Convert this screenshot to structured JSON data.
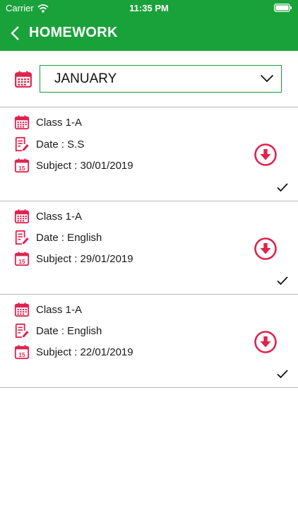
{
  "status_bar": {
    "carrier": "Carrier",
    "time": "11:35 PM"
  },
  "header": {
    "title": "HOMEWORK",
    "back_icon": "chevron-left-icon"
  },
  "filter": {
    "month": "JANUARY",
    "calendar_icon": "calendar-icon",
    "dropdown_icon": "chevron-down-icon"
  },
  "colors": {
    "header_bg": "#1aa23a",
    "accent_red": "#e0234e",
    "border_green": "#1a9a3a"
  },
  "homework": [
    {
      "class": "Class 1-A",
      "date": "Date : S.S",
      "subject": "Subject : 30/01/2019"
    },
    {
      "class": "Class 1-A",
      "date": "Date : English",
      "subject": "Subject : 29/01/2019"
    },
    {
      "class": "Class 1-A",
      "date": "Date : English",
      "subject": "Subject : 22/01/2019"
    }
  ]
}
